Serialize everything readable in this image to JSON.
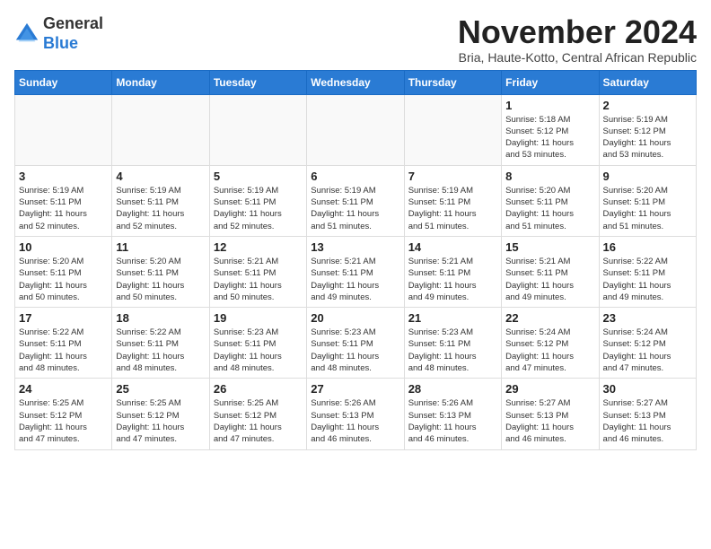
{
  "logo": {
    "general": "General",
    "blue": "Blue"
  },
  "header": {
    "title": "November 2024",
    "subtitle": "Bria, Haute-Kotto, Central African Republic"
  },
  "weekdays": [
    "Sunday",
    "Monday",
    "Tuesday",
    "Wednesday",
    "Thursday",
    "Friday",
    "Saturday"
  ],
  "weeks": [
    [
      {
        "day": "",
        "info": "",
        "empty": true
      },
      {
        "day": "",
        "info": "",
        "empty": true
      },
      {
        "day": "",
        "info": "",
        "empty": true
      },
      {
        "day": "",
        "info": "",
        "empty": true
      },
      {
        "day": "",
        "info": "",
        "empty": true
      },
      {
        "day": "1",
        "info": "Sunrise: 5:18 AM\nSunset: 5:12 PM\nDaylight: 11 hours\nand 53 minutes.",
        "empty": false
      },
      {
        "day": "2",
        "info": "Sunrise: 5:19 AM\nSunset: 5:12 PM\nDaylight: 11 hours\nand 53 minutes.",
        "empty": false
      }
    ],
    [
      {
        "day": "3",
        "info": "Sunrise: 5:19 AM\nSunset: 5:11 PM\nDaylight: 11 hours\nand 52 minutes.",
        "empty": false
      },
      {
        "day": "4",
        "info": "Sunrise: 5:19 AM\nSunset: 5:11 PM\nDaylight: 11 hours\nand 52 minutes.",
        "empty": false
      },
      {
        "day": "5",
        "info": "Sunrise: 5:19 AM\nSunset: 5:11 PM\nDaylight: 11 hours\nand 52 minutes.",
        "empty": false
      },
      {
        "day": "6",
        "info": "Sunrise: 5:19 AM\nSunset: 5:11 PM\nDaylight: 11 hours\nand 51 minutes.",
        "empty": false
      },
      {
        "day": "7",
        "info": "Sunrise: 5:19 AM\nSunset: 5:11 PM\nDaylight: 11 hours\nand 51 minutes.",
        "empty": false
      },
      {
        "day": "8",
        "info": "Sunrise: 5:20 AM\nSunset: 5:11 PM\nDaylight: 11 hours\nand 51 minutes.",
        "empty": false
      },
      {
        "day": "9",
        "info": "Sunrise: 5:20 AM\nSunset: 5:11 PM\nDaylight: 11 hours\nand 51 minutes.",
        "empty": false
      }
    ],
    [
      {
        "day": "10",
        "info": "Sunrise: 5:20 AM\nSunset: 5:11 PM\nDaylight: 11 hours\nand 50 minutes.",
        "empty": false
      },
      {
        "day": "11",
        "info": "Sunrise: 5:20 AM\nSunset: 5:11 PM\nDaylight: 11 hours\nand 50 minutes.",
        "empty": false
      },
      {
        "day": "12",
        "info": "Sunrise: 5:21 AM\nSunset: 5:11 PM\nDaylight: 11 hours\nand 50 minutes.",
        "empty": false
      },
      {
        "day": "13",
        "info": "Sunrise: 5:21 AM\nSunset: 5:11 PM\nDaylight: 11 hours\nand 49 minutes.",
        "empty": false
      },
      {
        "day": "14",
        "info": "Sunrise: 5:21 AM\nSunset: 5:11 PM\nDaylight: 11 hours\nand 49 minutes.",
        "empty": false
      },
      {
        "day": "15",
        "info": "Sunrise: 5:21 AM\nSunset: 5:11 PM\nDaylight: 11 hours\nand 49 minutes.",
        "empty": false
      },
      {
        "day": "16",
        "info": "Sunrise: 5:22 AM\nSunset: 5:11 PM\nDaylight: 11 hours\nand 49 minutes.",
        "empty": false
      }
    ],
    [
      {
        "day": "17",
        "info": "Sunrise: 5:22 AM\nSunset: 5:11 PM\nDaylight: 11 hours\nand 48 minutes.",
        "empty": false
      },
      {
        "day": "18",
        "info": "Sunrise: 5:22 AM\nSunset: 5:11 PM\nDaylight: 11 hours\nand 48 minutes.",
        "empty": false
      },
      {
        "day": "19",
        "info": "Sunrise: 5:23 AM\nSunset: 5:11 PM\nDaylight: 11 hours\nand 48 minutes.",
        "empty": false
      },
      {
        "day": "20",
        "info": "Sunrise: 5:23 AM\nSunset: 5:11 PM\nDaylight: 11 hours\nand 48 minutes.",
        "empty": false
      },
      {
        "day": "21",
        "info": "Sunrise: 5:23 AM\nSunset: 5:11 PM\nDaylight: 11 hours\nand 48 minutes.",
        "empty": false
      },
      {
        "day": "22",
        "info": "Sunrise: 5:24 AM\nSunset: 5:12 PM\nDaylight: 11 hours\nand 47 minutes.",
        "empty": false
      },
      {
        "day": "23",
        "info": "Sunrise: 5:24 AM\nSunset: 5:12 PM\nDaylight: 11 hours\nand 47 minutes.",
        "empty": false
      }
    ],
    [
      {
        "day": "24",
        "info": "Sunrise: 5:25 AM\nSunset: 5:12 PM\nDaylight: 11 hours\nand 47 minutes.",
        "empty": false
      },
      {
        "day": "25",
        "info": "Sunrise: 5:25 AM\nSunset: 5:12 PM\nDaylight: 11 hours\nand 47 minutes.",
        "empty": false
      },
      {
        "day": "26",
        "info": "Sunrise: 5:25 AM\nSunset: 5:12 PM\nDaylight: 11 hours\nand 47 minutes.",
        "empty": false
      },
      {
        "day": "27",
        "info": "Sunrise: 5:26 AM\nSunset: 5:13 PM\nDaylight: 11 hours\nand 46 minutes.",
        "empty": false
      },
      {
        "day": "28",
        "info": "Sunrise: 5:26 AM\nSunset: 5:13 PM\nDaylight: 11 hours\nand 46 minutes.",
        "empty": false
      },
      {
        "day": "29",
        "info": "Sunrise: 5:27 AM\nSunset: 5:13 PM\nDaylight: 11 hours\nand 46 minutes.",
        "empty": false
      },
      {
        "day": "30",
        "info": "Sunrise: 5:27 AM\nSunset: 5:13 PM\nDaylight: 11 hours\nand 46 minutes.",
        "empty": false
      }
    ]
  ]
}
